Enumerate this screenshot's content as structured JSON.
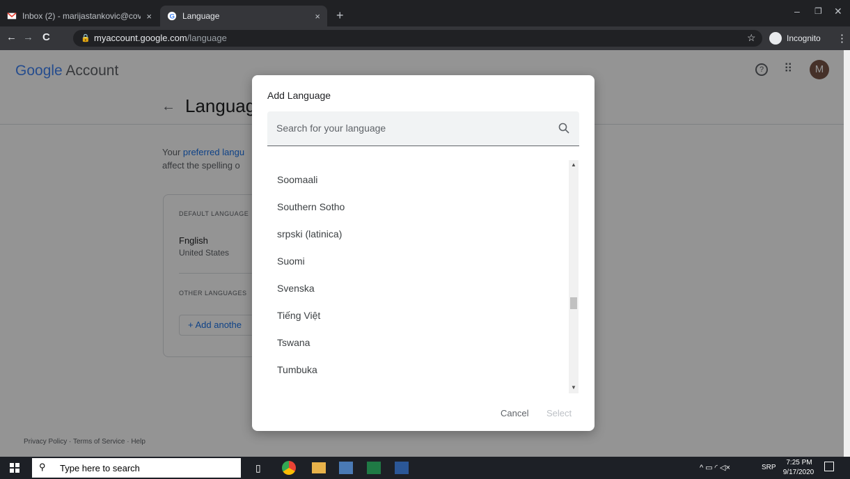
{
  "browser": {
    "tabs": [
      {
        "title": "Inbox (2) - marijastankovic@covi",
        "close": "×"
      },
      {
        "title": "Language",
        "close": "×"
      }
    ],
    "new_tab": "+",
    "url_host": "myaccount.google.com",
    "url_path": "/language",
    "incognito_label": "Incognito"
  },
  "page": {
    "logo_google": "Google",
    "logo_account": "Account",
    "title": "Languag",
    "intro_link": "preferred langu",
    "intro_prefix": "Your ",
    "intro_line2": "affect the spelling o",
    "default_language_header": "DEFAULT LANGUAGE",
    "default_language_name": "Fnglish",
    "default_language_region": "United States",
    "other_languages_header": "OTHER LANGUAGES",
    "add_another": "Add anothe",
    "avatar_letter": "M",
    "footer": {
      "privacy": "Privacy Policy",
      "terms": "Terms of Service",
      "help": "Help"
    }
  },
  "dialog": {
    "title": "Add Language",
    "search_placeholder": "Search for your language",
    "languages": [
      "Soomaali",
      "Southern Sotho",
      "srpski (latinica)",
      "Suomi",
      "Svenska",
      "Tiếng Việt",
      "Tswana",
      "Tumbuka"
    ],
    "cancel": "Cancel",
    "select": "Select"
  },
  "taskbar": {
    "search_placeholder": "Type here to search",
    "language": "SRP",
    "time": "7:25 PM",
    "date": "9/17/2020"
  },
  "colors": {
    "accent": "#1a73e8",
    "dialog_bg": "#ffffff"
  }
}
